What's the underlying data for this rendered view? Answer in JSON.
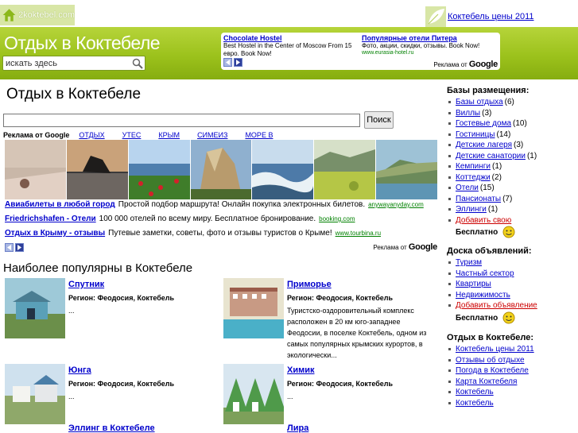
{
  "header": {
    "logo_text": "2koktebel.com",
    "top_link": "Коктебель цены 2011",
    "site_title": "Отдых в Коктебеле",
    "search_placeholder": "искать здесь"
  },
  "top_ad": {
    "ads": [
      {
        "title": "Chocolate Hostel",
        "text": "Best Hostel in the Center of Moscow From 15 евро. Book Now!",
        "url": ""
      },
      {
        "title": "Популярные отели Питера",
        "text": "Фото, акции, скидки, отзывы. Book Now!",
        "url": "www.eurasia-hotel.ru"
      }
    ],
    "ads_by": "Реклама от",
    "google": "Google"
  },
  "main": {
    "heading": "Отдых в Коктебеле",
    "search_button": "Поиск",
    "ads_by": "Реклама от Google",
    "tabs": [
      "ОТДЫХ",
      "УТЕС",
      "КРЫМ",
      "СИМЕИЗ",
      "МОРЕ В"
    ],
    "text_ads": [
      {
        "title": "Авиабилеты в любой город",
        "text": "Простой подбор маршрута! Онлайн покупка электронных билетов.",
        "url": "anywayanyday.com"
      },
      {
        "title": "Friedrichshafen - Отели",
        "text": "100 000 отелей по всему миру. Бесплатное бронирование.",
        "url": "booking.com"
      },
      {
        "title": "Отдых в Крыму - отзывы",
        "text": "Путевые заметки, советы, фото и отзывы туристов о Крыме!",
        "url": "www.tourbina.ru"
      }
    ],
    "ads_footer_by": "Реклама от",
    "ads_footer_google": "Google",
    "popular_heading": "Наиболее популярны в Коктебеле",
    "cards": [
      {
        "name": "Спутник",
        "region": "Регион: Феодосия, Коктебель",
        "desc": "..."
      },
      {
        "name": "Приморье",
        "region": "Регион: Феодосия, Коктебель",
        "desc": "Туристско-оздоровительный комплекс расположен в 20 км юго-западнее Феодосии, в поселке Коктебель, одном из самых популярных крымских курортов, в экологически..."
      },
      {
        "name": "Юнга",
        "region": "Регион: Феодосия, Коктебель",
        "desc": "..."
      },
      {
        "name": "Химик",
        "region": "Регион: Феодосия, Коктебель",
        "desc": "..."
      },
      {
        "name": "Эллинг в Коктебеле",
        "region": "",
        "desc": ""
      },
      {
        "name": "Лира",
        "region": "",
        "desc": ""
      }
    ]
  },
  "sidebar": {
    "bases_heading": "Базы размещения:",
    "bases": [
      {
        "label": "Базы отдыха",
        "count": "(6)"
      },
      {
        "label": "Виллы",
        "count": "(3)"
      },
      {
        "label": "Гостевые дома",
        "count": "(10)"
      },
      {
        "label": "Гостиницы",
        "count": "(14)"
      },
      {
        "label": "Детские лагеря",
        "count": "(3)"
      },
      {
        "label": "Детские санатории",
        "count": "(1)"
      },
      {
        "label": "Кемпинги",
        "count": "(1)"
      },
      {
        "label": "Коттеджи",
        "count": "(2)"
      },
      {
        "label": "Отели",
        "count": "(15)"
      },
      {
        "label": "Пансионаты",
        "count": "(7)"
      },
      {
        "label": "Эллинги",
        "count": "(1)"
      }
    ],
    "add_own": "Добавить свою",
    "free1": "Бесплатно",
    "board_heading": "Доска объявлений:",
    "board": [
      "Туризм",
      "Частный сектор",
      "Квартиры",
      "Недвижимость"
    ],
    "add_ad": "Добавить объявление",
    "free2": "Бесплатно",
    "rest_heading": "Отдых в Коктебеле:",
    "rest": [
      "Коктебель цены 2011",
      "Отзывы об отдыхе",
      "Погода в Коктебеле",
      "Карта Коктебеля",
      "Коктебель",
      "Коктебель"
    ]
  },
  "colors": {
    "brand_green": "#9cc21c",
    "link": "#0000cc",
    "add_link": "#cc0000",
    "url_green": "#008000"
  }
}
